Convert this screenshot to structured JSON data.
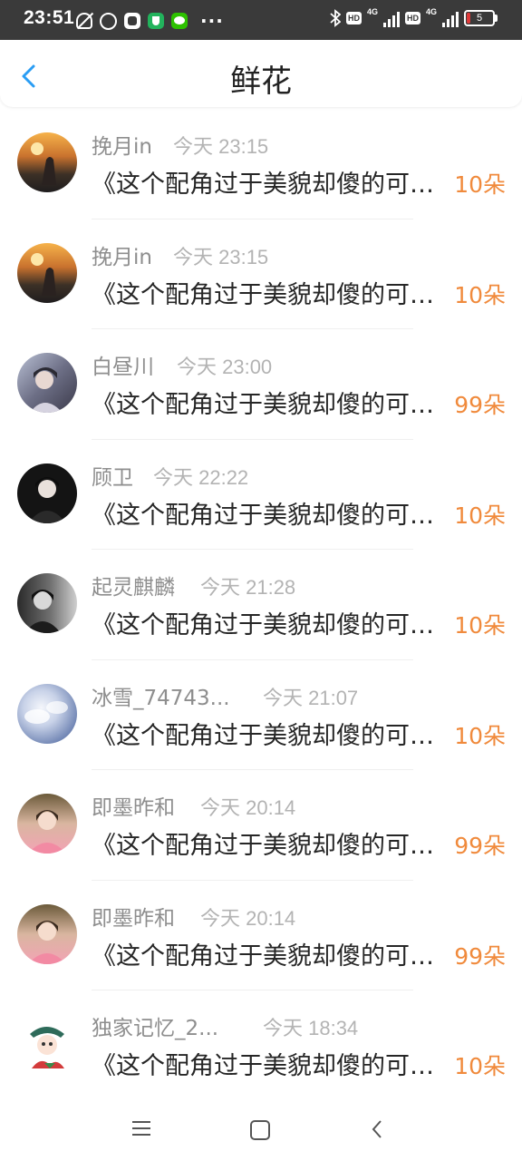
{
  "status_bar": {
    "time": "23:51",
    "net_label_1": "4G",
    "net_label_2": "4G",
    "hd_label": "HD",
    "battery": "5",
    "more": "···"
  },
  "header": {
    "title": "鲜花"
  },
  "colors": {
    "accent_blue": "#2a9df4",
    "count_orange": "#f08a3c",
    "name_gray": "#8e8e8e",
    "time_gray": "#b3b3b3"
  },
  "items": [
    {
      "name": "挽月in",
      "time": "今天 23:15",
      "book": "《这个配角过于美貌却傻的可怜》",
      "count": "10朵"
    },
    {
      "name": "挽月in",
      "time": "今天 23:15",
      "book": "《这个配角过于美貌却傻的可怜》",
      "count": "10朵"
    },
    {
      "name": "白昼川",
      "time": "今天 23:00",
      "book": "《这个配角过于美貌却傻的可怜》",
      "count": "99朵"
    },
    {
      "name": "顾卫",
      "time": "今天 22:22",
      "book": "《这个配角过于美貌却傻的可怜》",
      "count": "10朵"
    },
    {
      "name": "起灵麒麟",
      "time": "今天 21:28",
      "book": "《这个配角过于美貌却傻的可怜》",
      "count": "10朵"
    },
    {
      "name": "冰雪_74743...",
      "time": "今天 21:07",
      "book": "《这个配角过于美貌却傻的可怜》",
      "count": "10朵"
    },
    {
      "name": "即墨昨和",
      "time": "今天 20:14",
      "book": "《这个配角过于美貌却傻的可怜》",
      "count": "99朵"
    },
    {
      "name": "即墨昨和",
      "time": "今天 20:14",
      "book": "《这个配角过于美貌却傻的可怜》",
      "count": "99朵"
    },
    {
      "name": "独家记忆_2...",
      "time": "今天 18:34",
      "book": "《这个配角过于美貌却傻的可怜》",
      "count": "10朵"
    }
  ]
}
